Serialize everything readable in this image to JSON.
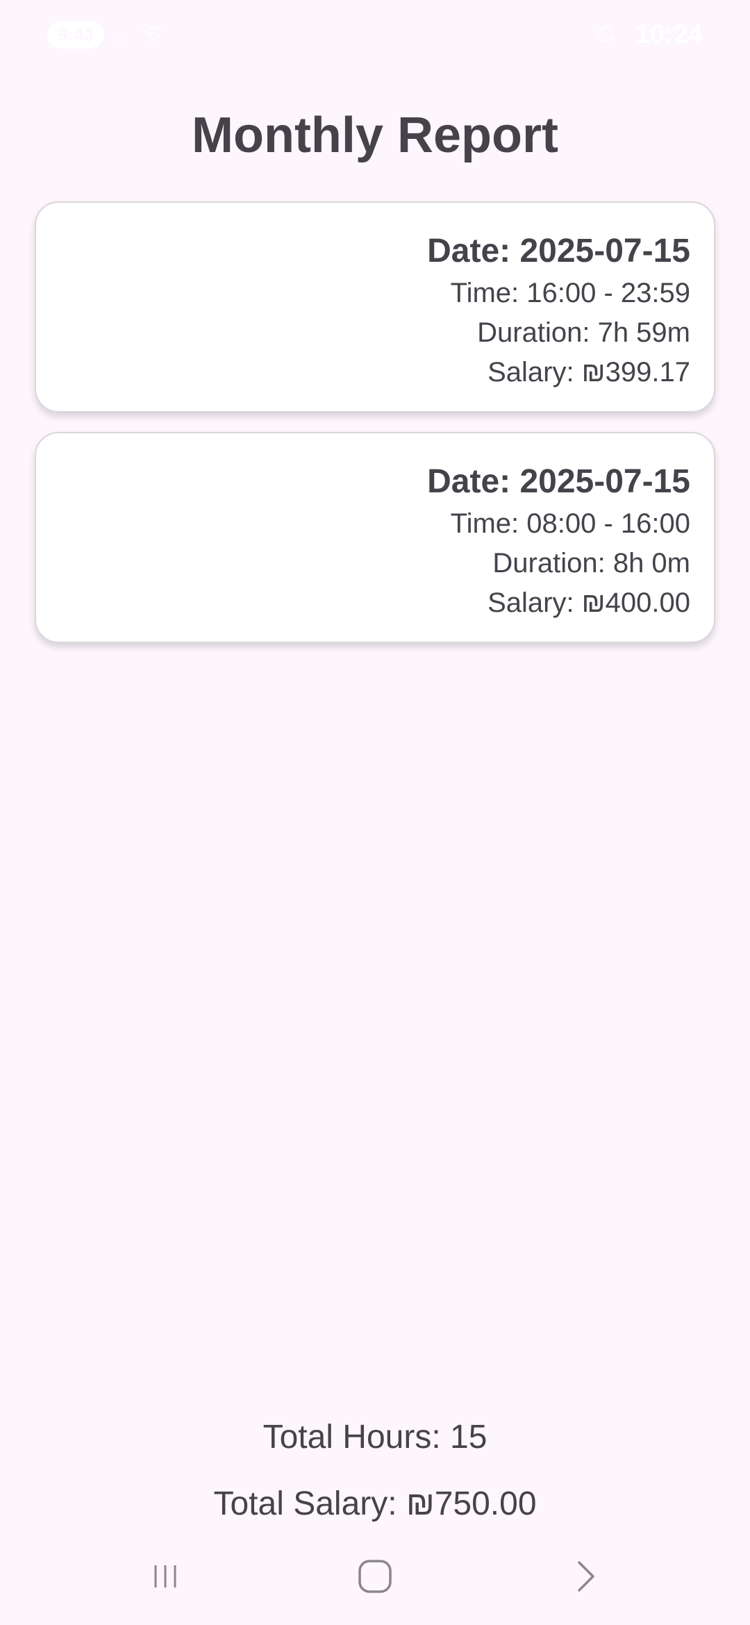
{
  "status_bar": {
    "badge": "9:43",
    "time": "10:24",
    "icons": [
      "signal-icon",
      "wifi-icon",
      "sync-icon"
    ]
  },
  "page": {
    "title": "Monthly Report"
  },
  "shifts": [
    {
      "date": "Date: 2025-07-15",
      "time": "Time: 16:00 - 23:59",
      "duration": "Duration: 7h 59m",
      "salary": "Salary: ₪399.17"
    },
    {
      "date": "Date: 2025-07-15",
      "time": "Time: 08:00 - 16:00",
      "duration": "Duration: 8h 0m",
      "salary": "Salary: ₪400.00"
    }
  ],
  "totals": {
    "hours": "Total Hours: 15",
    "salary": "Total Salary: ₪750.00"
  },
  "nav": {
    "icons": [
      "recent-apps-icon",
      "home-icon",
      "back-icon"
    ]
  },
  "colors": {
    "background": "#fdf6fd",
    "card": "#ffffff",
    "text": "#45424a",
    "card_border": "#dad6da"
  }
}
